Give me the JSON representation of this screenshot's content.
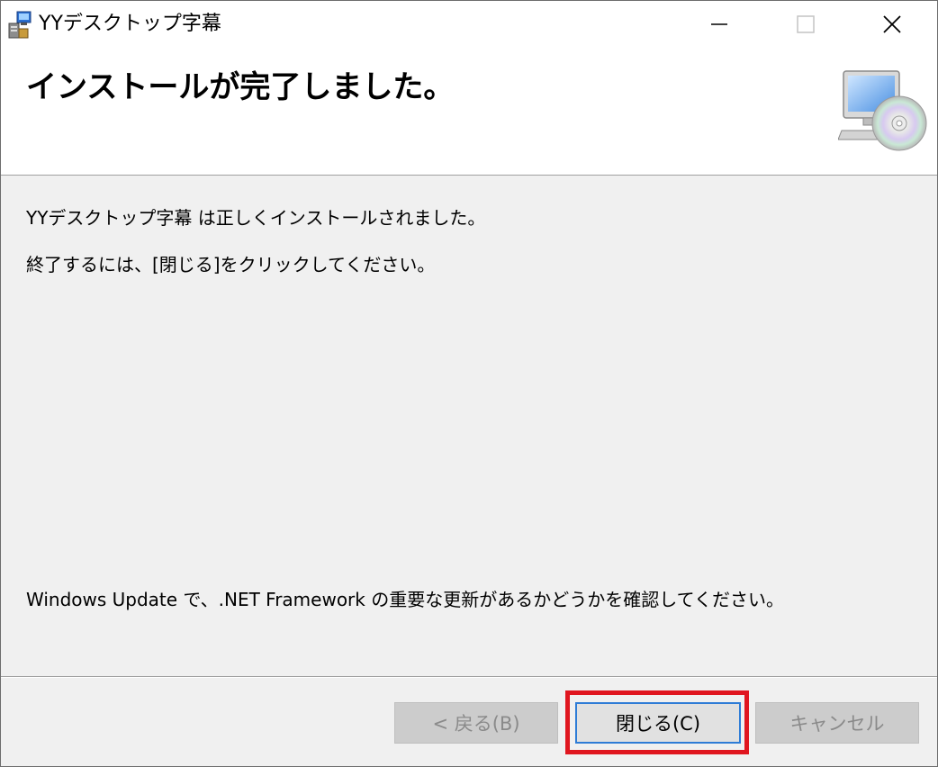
{
  "window": {
    "title": "YYデスクトップ字幕",
    "controls": {
      "minimize": "minimize-icon",
      "maximize": "maximize-icon",
      "close": "close-icon"
    }
  },
  "banner": {
    "heading": "インストールが完了しました。",
    "icon": "computer-cd-icon"
  },
  "body": {
    "line1": "YYデスクトップ字幕 は正しくインストールされました。",
    "line2": "終了するには、[閉じる]をクリックしてください。",
    "line3": "Windows Update で、.NET Framework の重要な更新があるかどうかを確認してください。"
  },
  "buttons": {
    "back": "< 戻る(B)",
    "close": "閉じる(C)",
    "cancel": "キャンセル"
  },
  "colors": {
    "highlight": "#e0161f",
    "focus_border": "#2e7cd6",
    "dialog_bg": "#f0f0f0"
  }
}
